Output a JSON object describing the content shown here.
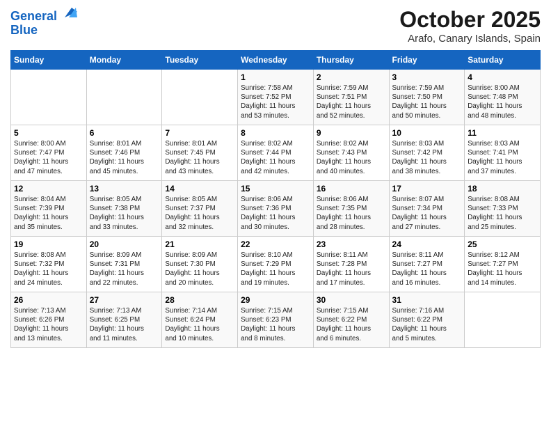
{
  "header": {
    "logo_line1": "General",
    "logo_line2": "Blue",
    "month": "October 2025",
    "location": "Arafo, Canary Islands, Spain"
  },
  "weekdays": [
    "Sunday",
    "Monday",
    "Tuesday",
    "Wednesday",
    "Thursday",
    "Friday",
    "Saturday"
  ],
  "weeks": [
    [
      {
        "day": "",
        "info": ""
      },
      {
        "day": "",
        "info": ""
      },
      {
        "day": "",
        "info": ""
      },
      {
        "day": "1",
        "info": "Sunrise: 7:58 AM\nSunset: 7:52 PM\nDaylight: 11 hours\nand 53 minutes."
      },
      {
        "day": "2",
        "info": "Sunrise: 7:59 AM\nSunset: 7:51 PM\nDaylight: 11 hours\nand 52 minutes."
      },
      {
        "day": "3",
        "info": "Sunrise: 7:59 AM\nSunset: 7:50 PM\nDaylight: 11 hours\nand 50 minutes."
      },
      {
        "day": "4",
        "info": "Sunrise: 8:00 AM\nSunset: 7:48 PM\nDaylight: 11 hours\nand 48 minutes."
      }
    ],
    [
      {
        "day": "5",
        "info": "Sunrise: 8:00 AM\nSunset: 7:47 PM\nDaylight: 11 hours\nand 47 minutes."
      },
      {
        "day": "6",
        "info": "Sunrise: 8:01 AM\nSunset: 7:46 PM\nDaylight: 11 hours\nand 45 minutes."
      },
      {
        "day": "7",
        "info": "Sunrise: 8:01 AM\nSunset: 7:45 PM\nDaylight: 11 hours\nand 43 minutes."
      },
      {
        "day": "8",
        "info": "Sunrise: 8:02 AM\nSunset: 7:44 PM\nDaylight: 11 hours\nand 42 minutes."
      },
      {
        "day": "9",
        "info": "Sunrise: 8:02 AM\nSunset: 7:43 PM\nDaylight: 11 hours\nand 40 minutes."
      },
      {
        "day": "10",
        "info": "Sunrise: 8:03 AM\nSunset: 7:42 PM\nDaylight: 11 hours\nand 38 minutes."
      },
      {
        "day": "11",
        "info": "Sunrise: 8:03 AM\nSunset: 7:41 PM\nDaylight: 11 hours\nand 37 minutes."
      }
    ],
    [
      {
        "day": "12",
        "info": "Sunrise: 8:04 AM\nSunset: 7:39 PM\nDaylight: 11 hours\nand 35 minutes."
      },
      {
        "day": "13",
        "info": "Sunrise: 8:05 AM\nSunset: 7:38 PM\nDaylight: 11 hours\nand 33 minutes."
      },
      {
        "day": "14",
        "info": "Sunrise: 8:05 AM\nSunset: 7:37 PM\nDaylight: 11 hours\nand 32 minutes."
      },
      {
        "day": "15",
        "info": "Sunrise: 8:06 AM\nSunset: 7:36 PM\nDaylight: 11 hours\nand 30 minutes."
      },
      {
        "day": "16",
        "info": "Sunrise: 8:06 AM\nSunset: 7:35 PM\nDaylight: 11 hours\nand 28 minutes."
      },
      {
        "day": "17",
        "info": "Sunrise: 8:07 AM\nSunset: 7:34 PM\nDaylight: 11 hours\nand 27 minutes."
      },
      {
        "day": "18",
        "info": "Sunrise: 8:08 AM\nSunset: 7:33 PM\nDaylight: 11 hours\nand 25 minutes."
      }
    ],
    [
      {
        "day": "19",
        "info": "Sunrise: 8:08 AM\nSunset: 7:32 PM\nDaylight: 11 hours\nand 24 minutes."
      },
      {
        "day": "20",
        "info": "Sunrise: 8:09 AM\nSunset: 7:31 PM\nDaylight: 11 hours\nand 22 minutes."
      },
      {
        "day": "21",
        "info": "Sunrise: 8:09 AM\nSunset: 7:30 PM\nDaylight: 11 hours\nand 20 minutes."
      },
      {
        "day": "22",
        "info": "Sunrise: 8:10 AM\nSunset: 7:29 PM\nDaylight: 11 hours\nand 19 minutes."
      },
      {
        "day": "23",
        "info": "Sunrise: 8:11 AM\nSunset: 7:28 PM\nDaylight: 11 hours\nand 17 minutes."
      },
      {
        "day": "24",
        "info": "Sunrise: 8:11 AM\nSunset: 7:27 PM\nDaylight: 11 hours\nand 16 minutes."
      },
      {
        "day": "25",
        "info": "Sunrise: 8:12 AM\nSunset: 7:27 PM\nDaylight: 11 hours\nand 14 minutes."
      }
    ],
    [
      {
        "day": "26",
        "info": "Sunrise: 7:13 AM\nSunset: 6:26 PM\nDaylight: 11 hours\nand 13 minutes."
      },
      {
        "day": "27",
        "info": "Sunrise: 7:13 AM\nSunset: 6:25 PM\nDaylight: 11 hours\nand 11 minutes."
      },
      {
        "day": "28",
        "info": "Sunrise: 7:14 AM\nSunset: 6:24 PM\nDaylight: 11 hours\nand 10 minutes."
      },
      {
        "day": "29",
        "info": "Sunrise: 7:15 AM\nSunset: 6:23 PM\nDaylight: 11 hours\nand 8 minutes."
      },
      {
        "day": "30",
        "info": "Sunrise: 7:15 AM\nSunset: 6:22 PM\nDaylight: 11 hours\nand 6 minutes."
      },
      {
        "day": "31",
        "info": "Sunrise: 7:16 AM\nSunset: 6:22 PM\nDaylight: 11 hours\nand 5 minutes."
      },
      {
        "day": "",
        "info": ""
      }
    ]
  ]
}
